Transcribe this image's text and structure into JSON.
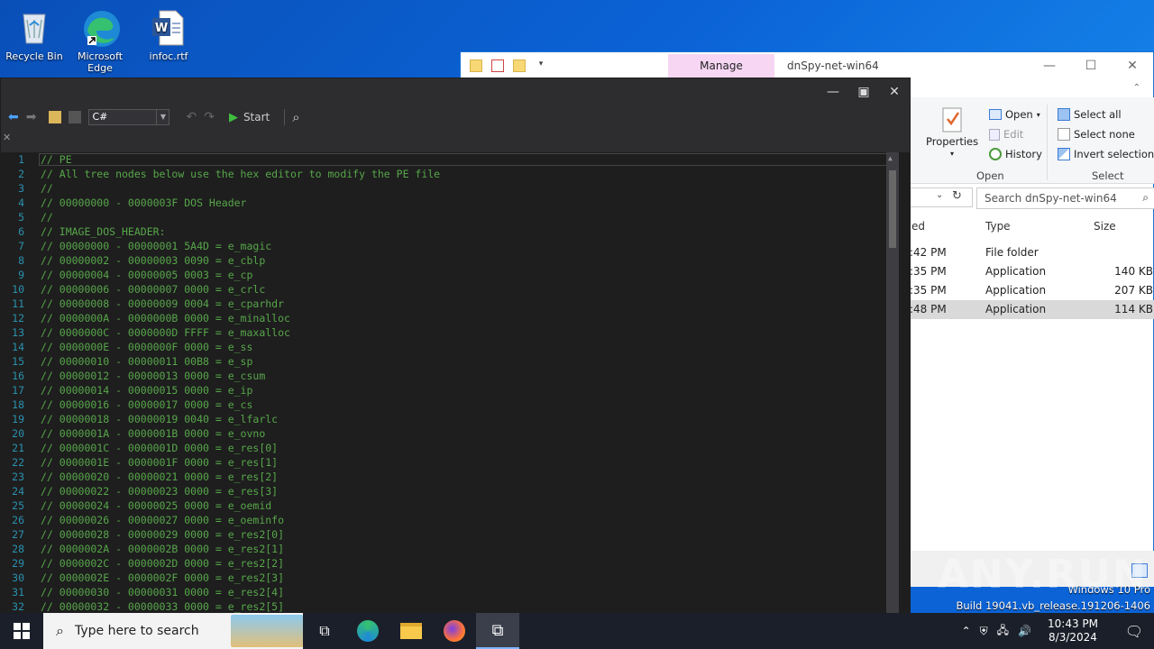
{
  "desktop": {
    "icons": [
      {
        "label": "Recycle Bin"
      },
      {
        "label": "Microsoft Edge"
      },
      {
        "label": "infoc.rtf"
      }
    ]
  },
  "explorer": {
    "manage_tab": "Manage",
    "title": "dnSpy-net-win64",
    "ribbon": {
      "properties": "Properties",
      "open": "Open",
      "edit": "Edit",
      "history": "History",
      "open_group": "Open",
      "select_all": "Select all",
      "select_none": "Select none",
      "invert_selection": "Invert selection",
      "select_group": "Select"
    },
    "search_placeholder": "Search dnSpy-net-win64",
    "columns": {
      "modified": "ed",
      "type": "Type",
      "size": "Size"
    },
    "rows": [
      {
        "time": ":42 PM",
        "type": "File folder",
        "size": ""
      },
      {
        "time": ":35 PM",
        "type": "Application",
        "size": "140 KB"
      },
      {
        "time": ":35 PM",
        "type": "Application",
        "size": "207 KB"
      },
      {
        "time": ":48 PM",
        "type": "Application",
        "size": "114 KB"
      }
    ]
  },
  "watermark": {
    "brand": "ANY.RUN",
    "os": "Windows 10 Pro",
    "build": "Build 19041.vb_release.191206-1406"
  },
  "dnspy": {
    "language": "C#",
    "start_label": "Start",
    "code_lines": [
      "// PE",
      "// All tree nodes below use the hex editor to modify the PE file",
      "//",
      "// 00000000 - 0000003F DOS Header",
      "//",
      "// IMAGE_DOS_HEADER:",
      "// 00000000 - 00000001 5A4D = e_magic",
      "// 00000002 - 00000003 0090 = e_cblp",
      "// 00000004 - 00000005 0003 = e_cp",
      "// 00000006 - 00000007 0000 = e_crlc",
      "// 00000008 - 00000009 0004 = e_cparhdr",
      "// 0000000A - 0000000B 0000 = e_minalloc",
      "// 0000000C - 0000000D FFFF = e_maxalloc",
      "// 0000000E - 0000000F 0000 = e_ss",
      "// 00000010 - 00000011 00B8 = e_sp",
      "// 00000012 - 00000013 0000 = e_csum",
      "// 00000014 - 00000015 0000 = e_ip",
      "// 00000016 - 00000017 0000 = e_cs",
      "// 00000018 - 00000019 0040 = e_lfarlc",
      "// 0000001A - 0000001B 0000 = e_ovno",
      "// 0000001C - 0000001D 0000 = e_res[0]",
      "// 0000001E - 0000001F 0000 = e_res[1]",
      "// 00000020 - 00000021 0000 = e_res[2]",
      "// 00000022 - 00000023 0000 = e_res[3]",
      "// 00000024 - 00000025 0000 = e_oemid",
      "// 00000026 - 00000027 0000 = e_oeminfo",
      "// 00000028 - 00000029 0000 = e_res2[0]",
      "// 0000002A - 0000002B 0000 = e_res2[1]",
      "// 0000002C - 0000002D 0000 = e_res2[2]",
      "// 0000002E - 0000002F 0000 = e_res2[3]",
      "// 00000030 - 00000031 0000 = e_res2[4]",
      "// 00000032 - 00000033 0000 = e_res2[5]"
    ]
  },
  "taskbar": {
    "search_placeholder": "Type here to search",
    "time": "10:43 PM",
    "date": "8/3/2024"
  }
}
